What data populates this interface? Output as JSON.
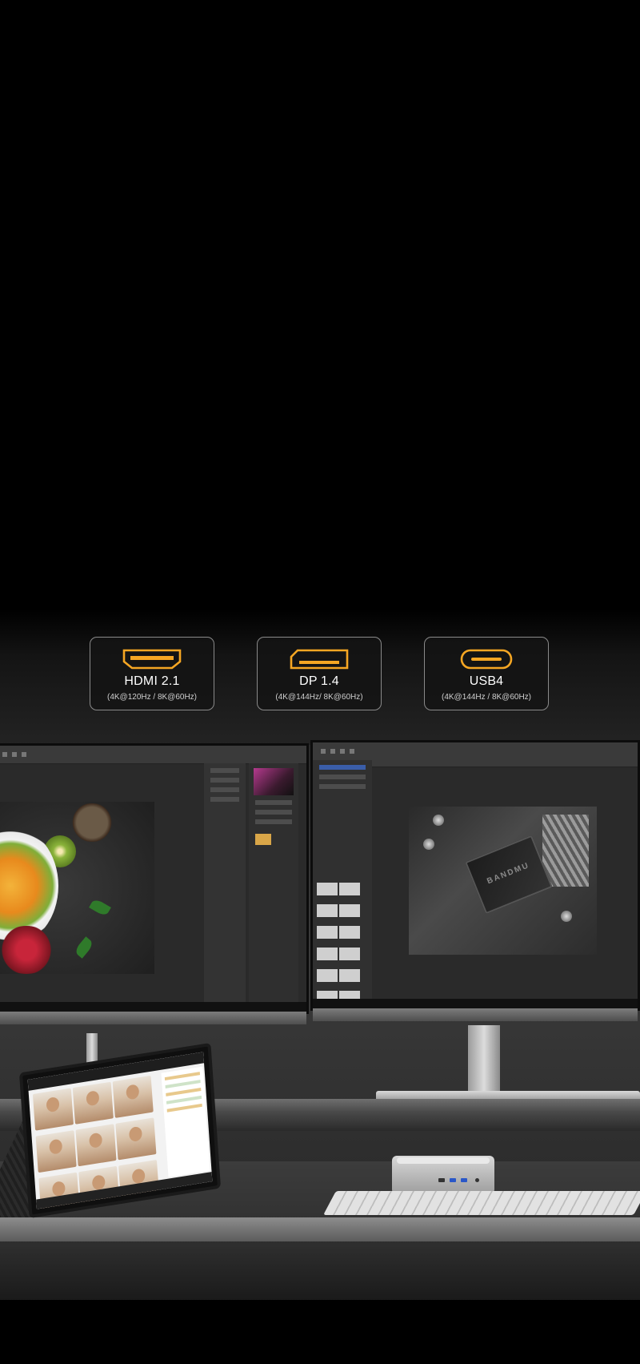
{
  "ports": [
    {
      "name": "HDMI 2.1",
      "spec": "(4K@120Hz / 8K@60Hz)",
      "icon": "hdmi-port-icon"
    },
    {
      "name": "DP 1.4",
      "spec": "(4K@144Hz/ 8K@60Hz)",
      "icon": "displayport-icon"
    },
    {
      "name": "USB4",
      "spec": "(4K@144Hz / 8K@60Hz)",
      "icon": "usb-c-port-icon"
    }
  ],
  "scene": {
    "chip_label": "BANDMU"
  },
  "colors": {
    "accent": "#f5a623",
    "card_border": "#8a8a8a",
    "background": "#000000"
  }
}
